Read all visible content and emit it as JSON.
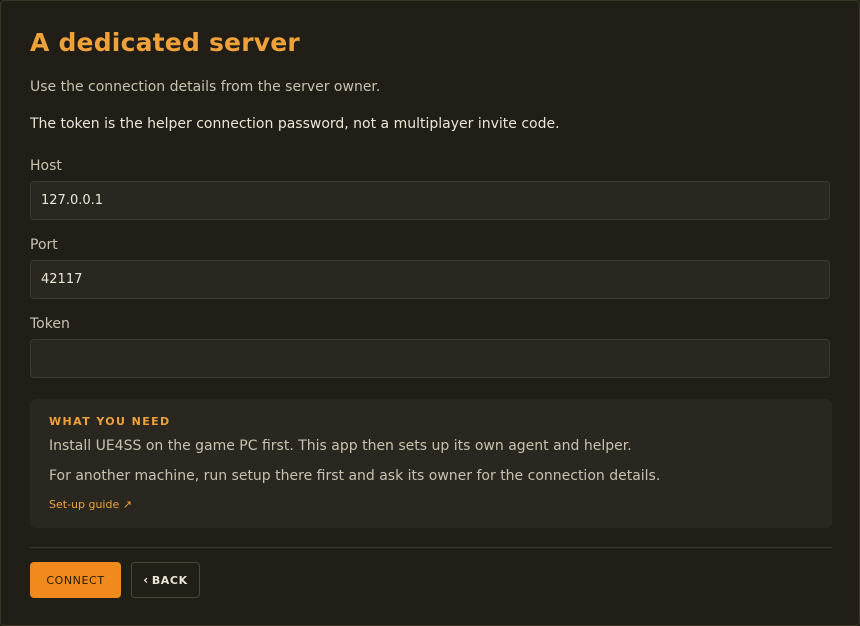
{
  "header": {
    "title": "A dedicated server",
    "description": "Use the connection details from the server owner.",
    "note": "The token is the helper connection password, not a multiplayer invite code."
  },
  "form": {
    "host": {
      "label": "Host",
      "value": "127.0.0.1",
      "placeholder": ""
    },
    "port": {
      "label": "Port",
      "value": "42117",
      "placeholder": ""
    },
    "token": {
      "label": "Token",
      "value": "",
      "placeholder": ""
    }
  },
  "info": {
    "heading": "WHAT YOU NEED",
    "line1": "Install UE4SS on the game PC first. This app then sets up its own agent and helper.",
    "line2": "For another machine, run setup there first and ask its owner for the connection details.",
    "link_label": "Set-up guide",
    "link_icon": "↗"
  },
  "actions": {
    "connect_label": "CONNECT",
    "back_icon": "‹",
    "back_label": "BACK"
  },
  "colors": {
    "accent": "#f0a23a",
    "primary_button": "#f08a1c",
    "background": "#211e17"
  }
}
